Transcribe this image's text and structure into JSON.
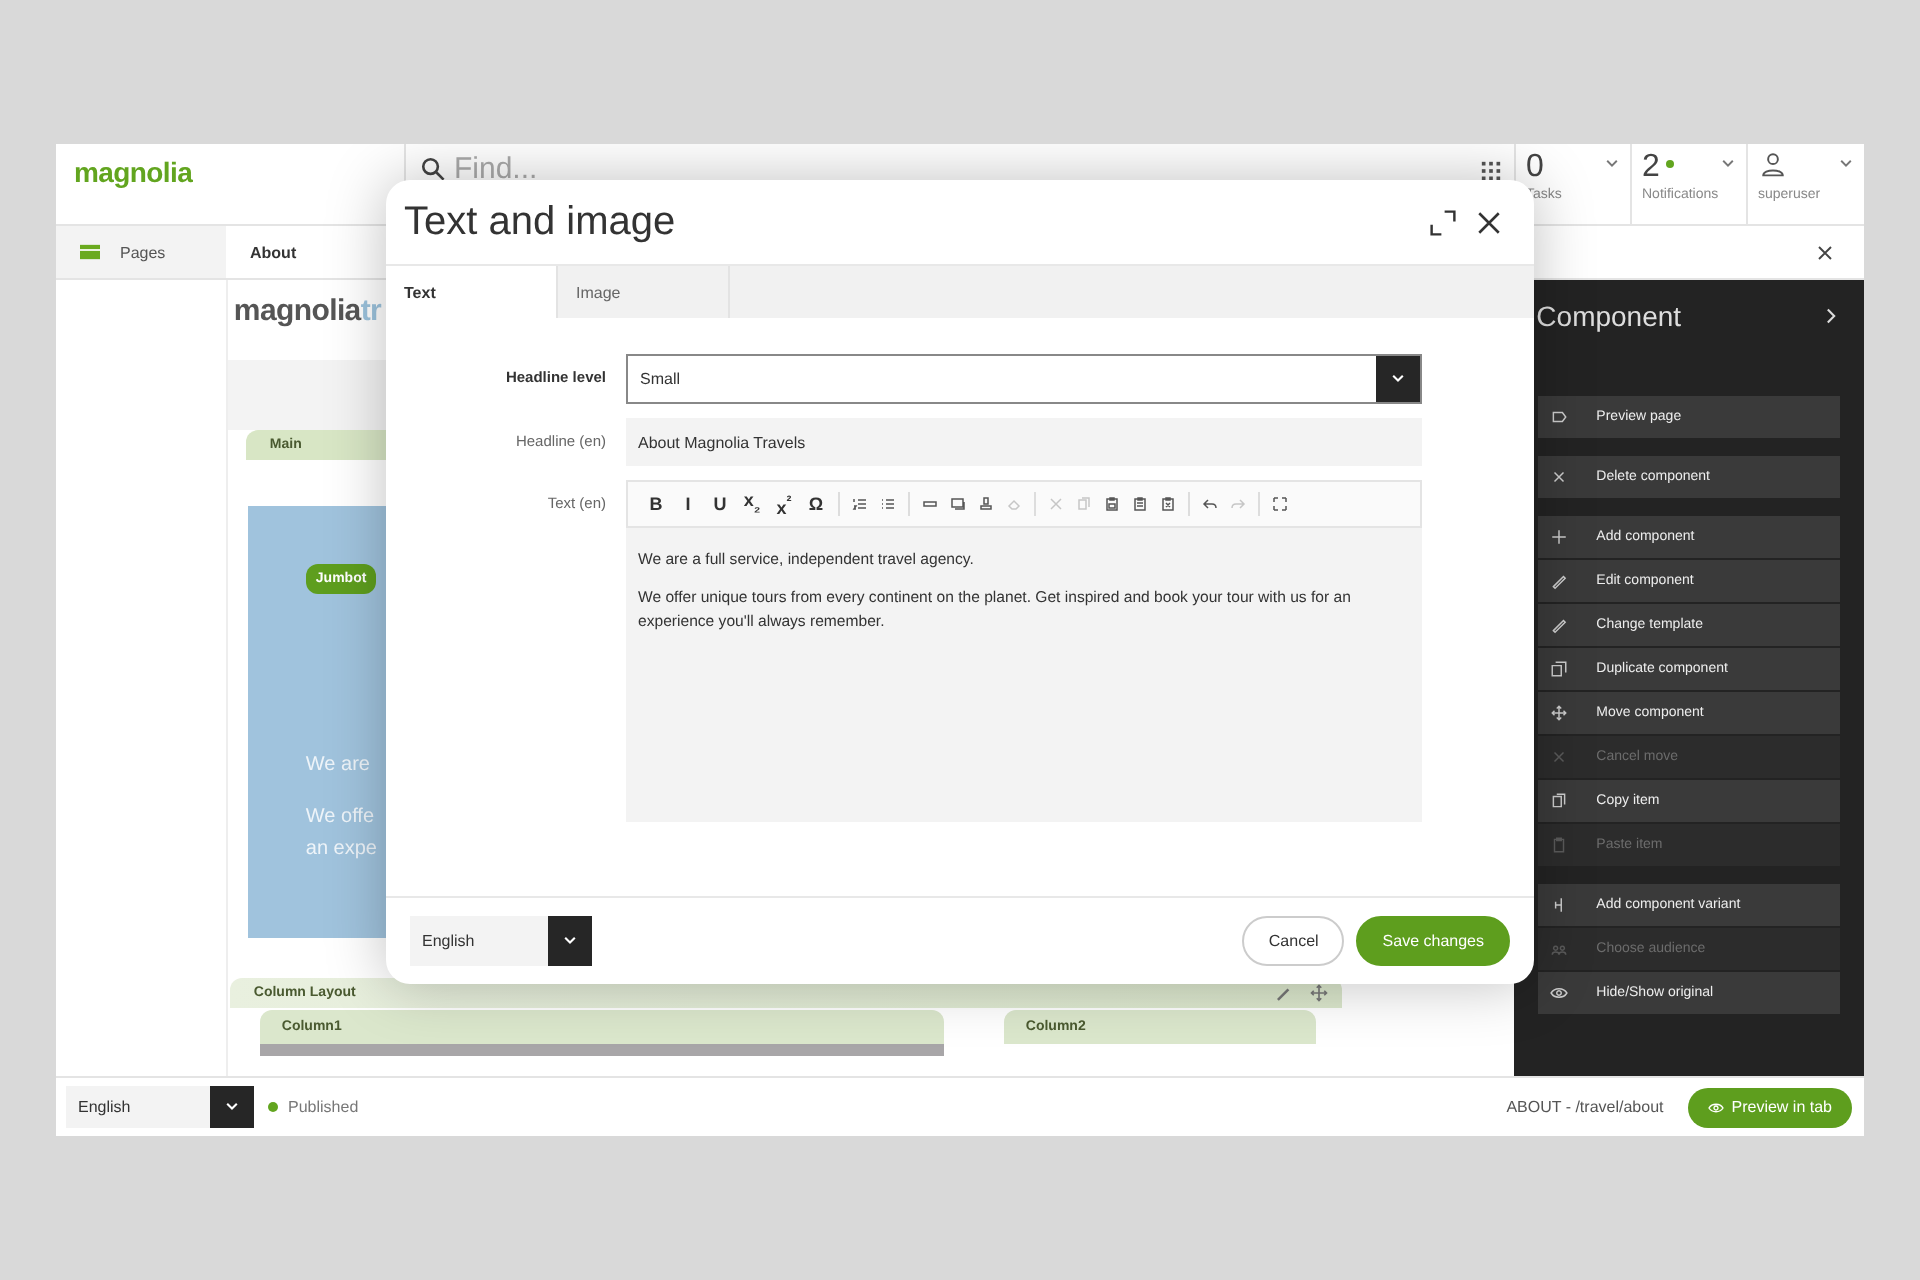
{
  "brand": {
    "logo": "magnolia"
  },
  "search": {
    "placeholder": "Find..."
  },
  "counters": [
    {
      "value": "0",
      "label": "Tasks",
      "dot": false
    },
    {
      "value": "2",
      "label": "Notifications",
      "dot": true
    }
  ],
  "user": {
    "name": "superuser"
  },
  "tabs": [
    {
      "label": "Pages",
      "selected": false
    },
    {
      "label": "About",
      "selected": true
    }
  ],
  "page_preview": {
    "logo": "magnolia",
    "logo_suffix": "tr",
    "area_label": "Main",
    "badge": "Jumbot",
    "lines": [
      "We are",
      "We offe",
      "an expe"
    ],
    "layout_label": "Column Layout",
    "columns": [
      "Column1",
      "Column2"
    ]
  },
  "panel": {
    "title": "Component",
    "groups": [
      [
        {
          "label": "Preview page",
          "disabled": false
        }
      ],
      [
        {
          "label": "Delete component",
          "disabled": false
        }
      ],
      [
        {
          "label": "Add component",
          "disabled": false
        },
        {
          "label": "Edit component",
          "disabled": false
        },
        {
          "label": "Change template",
          "disabled": false
        },
        {
          "label": "Duplicate component",
          "disabled": false
        },
        {
          "label": "Move component",
          "disabled": false
        },
        {
          "label": "Cancel move",
          "disabled": true
        },
        {
          "label": "Copy item",
          "disabled": false
        },
        {
          "label": "Paste item",
          "disabled": true
        }
      ],
      [
        {
          "label": "Add component variant",
          "disabled": false
        },
        {
          "label": "Choose audience",
          "disabled": true
        },
        {
          "label": "Hide/Show original",
          "disabled": false
        }
      ]
    ]
  },
  "dialog": {
    "title": "Text and image",
    "tabs": [
      {
        "label": "Text",
        "selected": true
      },
      {
        "label": "Image",
        "selected": false
      }
    ],
    "fields": [
      {
        "kind": "select",
        "label": "Headline level",
        "value": "Small",
        "focused": true
      },
      {
        "kind": "text",
        "label": "Headline (en)",
        "value": "About Magnolia Travels",
        "focused": false
      },
      {
        "kind": "richtext",
        "label": "Text (en)",
        "focused": false,
        "toolbar": [
          [
            {
              "kind": "glyph",
              "label": "B"
            },
            {
              "kind": "glyph",
              "label": "I"
            },
            {
              "kind": "glyph",
              "label": "U"
            },
            {
              "kind": "glyph",
              "label": "x$_{₂}$"
            },
            {
              "kind": "glyph",
              "label": "x$^{²}$"
            },
            {
              "kind": "glyph",
              "label": "Ω"
            }
          ],
          [
            {
              "kind": "icon",
              "disabled": false
            },
            {
              "kind": "icon",
              "disabled": false
            }
          ],
          [
            {
              "kind": "icon",
              "disabled": false
            },
            {
              "kind": "icon",
              "disabled": false
            },
            {
              "kind": "icon",
              "disabled": false
            },
            {
              "kind": "icon",
              "disabled": true
            }
          ],
          [
            {
              "kind": "icon",
              "disabled": true
            },
            {
              "kind": "icon",
              "disabled": true
            },
            {
              "kind": "icon",
              "disabled": false
            },
            {
              "kind": "icon",
              "disabled": false
            },
            {
              "kind": "icon",
              "disabled": false
            }
          ],
          [
            {
              "kind": "icon",
              "disabled": false
            },
            {
              "kind": "icon",
              "disabled": true
            }
          ],
          [
            {
              "kind": "icon",
              "disabled": false
            }
          ]
        ],
        "paragraphs": [
          "We are a full service, independent travel agency.",
          "We offer unique tours from every continent on the planet. Get inspired and book your tour with us for an experience you'll always remember."
        ]
      }
    ],
    "language": "English",
    "buttons": [
      {
        "label": "Cancel",
        "kind": "secondary"
      },
      {
        "label": "Save changes",
        "kind": "primary"
      }
    ]
  },
  "status_bar": {
    "language": "English",
    "status": "Published",
    "path": "ABOUT - /travel/about",
    "preview_button": "Preview in tab"
  }
}
